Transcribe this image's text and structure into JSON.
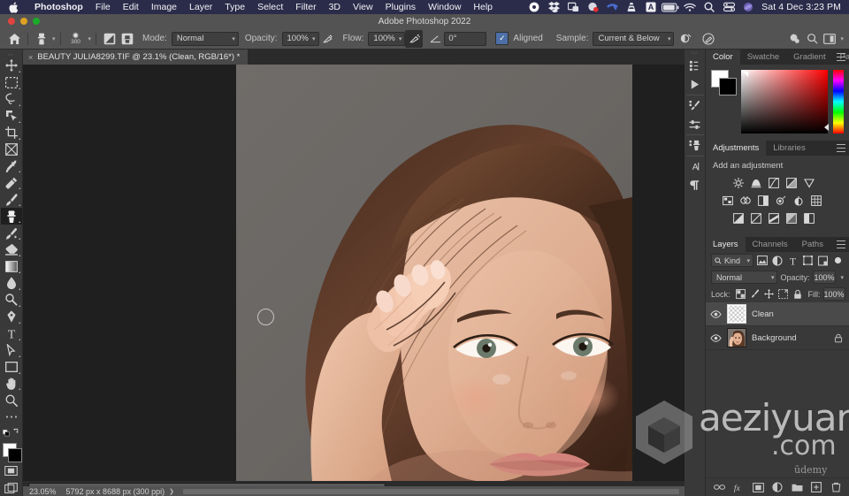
{
  "macbar": {
    "apple_icon": "apple-logo-icon",
    "menus": [
      {
        "label": "Photoshop",
        "bold": true
      },
      {
        "label": "File",
        "bold": false
      },
      {
        "label": "Edit",
        "bold": false
      },
      {
        "label": "Image",
        "bold": false
      },
      {
        "label": "Layer",
        "bold": false
      },
      {
        "label": "Type",
        "bold": false
      },
      {
        "label": "Select",
        "bold": false
      },
      {
        "label": "Filter",
        "bold": false
      },
      {
        "label": "3D",
        "bold": false
      },
      {
        "label": "View",
        "bold": false
      },
      {
        "label": "Plugins",
        "bold": false
      },
      {
        "label": "Window",
        "bold": false
      },
      {
        "label": "Help",
        "bold": false
      }
    ],
    "status_icons": [
      "onedrive-icon",
      "dropbox-icon",
      "screenshot-icon",
      "creative-cloud-icon",
      "phone-icon",
      "vlc-icon",
      "input-source-icon",
      "battery-icon",
      "wifi-icon",
      "spotlight-search-icon",
      "control-center-icon",
      "siri-icon"
    ],
    "clock": "Sat 4 Dec  3:23 PM",
    "bar_color": "#2b2c4a"
  },
  "window": {
    "title": "Adobe Photoshop 2022",
    "traffic_lights": [
      "close-button",
      "minimize-button",
      "zoom-button"
    ]
  },
  "options_bar": {
    "home_icon": "home-icon",
    "tool_preset_icon": "clone-stamp-preset-icon",
    "brush_size": "300",
    "toggle_brush_panel_icon": "brush-settings-panel-icon",
    "toggle_clone_source_icon": "clone-source-panel-icon",
    "mode_label": "Mode:",
    "mode_value": "Normal",
    "opacity_label": "Opacity:",
    "opacity_value": "100%",
    "opacity_pressure_icon": "pressure-opacity-icon",
    "flow_label": "Flow:",
    "flow_value": "100%",
    "airbrush_icon": "airbrush-icon",
    "smoothing_icon": "smoothing-angle-icon",
    "angle_value": "0°",
    "aligned_label": "Aligned",
    "aligned_checked": true,
    "sample_label": "Sample:",
    "sample_value": "Current & Below",
    "ignore_adjustment_icon": "ignore-adjustment-layers-icon",
    "pressure_size_icon": "pressure-size-icon",
    "right_icons": [
      "search-panels-icon",
      "search-icon",
      "workspace-switcher-icon"
    ]
  },
  "document": {
    "tab_title": "BEAUTY JULIA8299.TIF @ 23.1% (Clean, RGB/16*) *",
    "close_icon": "close-tab-icon"
  },
  "toolbar": {
    "tools": [
      {
        "name": "move-tool",
        "icon": "move-icon",
        "active": false,
        "hasflyout": true
      },
      {
        "name": "rectangular-marquee-tool",
        "icon": "marquee-icon",
        "active": false,
        "hasflyout": true
      },
      {
        "name": "lasso-tool",
        "icon": "lasso-icon",
        "active": false,
        "hasflyout": true
      },
      {
        "name": "object-selection-tool",
        "icon": "quick-select-icon",
        "active": false,
        "hasflyout": true
      },
      {
        "name": "crop-tool",
        "icon": "crop-icon",
        "active": false,
        "hasflyout": true
      },
      {
        "name": "frame-tool",
        "icon": "frame-icon",
        "active": false,
        "hasflyout": false
      },
      {
        "name": "eyedropper-tool",
        "icon": "eyedropper-icon",
        "active": false,
        "hasflyout": true
      },
      {
        "name": "spot-healing-brush-tool",
        "icon": "healing-brush-icon",
        "active": false,
        "hasflyout": true
      },
      {
        "name": "brush-tool",
        "icon": "brush-icon",
        "active": false,
        "hasflyout": true
      },
      {
        "name": "clone-stamp-tool",
        "icon": "clone-stamp-icon",
        "active": true,
        "hasflyout": true
      },
      {
        "name": "history-brush-tool",
        "icon": "history-brush-icon",
        "active": false,
        "hasflyout": true
      },
      {
        "name": "eraser-tool",
        "icon": "eraser-icon",
        "active": false,
        "hasflyout": true
      },
      {
        "name": "gradient-tool",
        "icon": "gradient-icon",
        "active": false,
        "hasflyout": true
      },
      {
        "name": "blur-tool",
        "icon": "blur-drop-icon",
        "active": false,
        "hasflyout": true
      },
      {
        "name": "dodge-tool",
        "icon": "dodge-icon",
        "active": false,
        "hasflyout": true
      },
      {
        "name": "pen-tool",
        "icon": "pen-icon",
        "active": false,
        "hasflyout": true
      },
      {
        "name": "type-tool",
        "icon": "type-T-icon",
        "active": false,
        "hasflyout": true
      },
      {
        "name": "path-selection-tool",
        "icon": "path-arrow-icon",
        "active": false,
        "hasflyout": true
      },
      {
        "name": "rectangle-tool",
        "icon": "rectangle-shape-icon",
        "active": false,
        "hasflyout": true
      },
      {
        "name": "hand-tool",
        "icon": "hand-icon",
        "active": false,
        "hasflyout": true
      },
      {
        "name": "zoom-tool",
        "icon": "zoom-magnifier-icon",
        "active": false,
        "hasflyout": false
      },
      {
        "name": "edit-toolbar-button",
        "icon": "ellipsis-icon",
        "active": false,
        "hasflyout": false
      }
    ],
    "default_colors_icon": "default-colors-icon",
    "swap_colors_icon": "swap-colors-icon",
    "foreground_color": "#ffffff",
    "background_color": "#000000",
    "quick_mask_icon": "quick-mask-icon",
    "screen_mode_icon": "screen-mode-icon"
  },
  "dock_rail": {
    "icons": [
      "history-panel-icon",
      "actions-play-icon",
      "brush-settings-icon",
      "brush-presets-icon",
      "clone-source-icon",
      "character-panel-icon",
      "paragraph-panel-icon"
    ]
  },
  "color_panel": {
    "tabs": [
      {
        "label": "Color",
        "active": true
      },
      {
        "label": "Swatche",
        "active": false
      },
      {
        "label": "Gradient",
        "active": false
      },
      {
        "label": "Patterns",
        "active": false
      }
    ],
    "menu_icon": "panel-menu-icon",
    "foreground_color": "#ffffff",
    "background_color": "#000000",
    "ramp": "hue-spectrum"
  },
  "adjustments_panel": {
    "tabs": [
      {
        "label": "Adjustments",
        "active": true
      },
      {
        "label": "Libraries",
        "active": false
      }
    ],
    "menu_icon": "panel-menu-icon",
    "title": "Add an adjustment",
    "rows": [
      [
        "brightness-contrast-icon",
        "levels-icon",
        "curves-icon",
        "exposure-icon",
        "vibrance-icon"
      ],
      [
        "hue-saturation-icon",
        "color-balance-icon",
        "black-white-icon",
        "photo-filter-icon",
        "channel-mixer-icon",
        "color-lookup-icon"
      ],
      [
        "invert-icon",
        "posterize-icon",
        "threshold-icon",
        "gradient-map-icon",
        "selective-color-icon"
      ]
    ]
  },
  "layers_panel": {
    "tabs": [
      {
        "label": "Layers",
        "active": true
      },
      {
        "label": "Channels",
        "active": false
      },
      {
        "label": "Paths",
        "active": false
      }
    ],
    "menu_icon": "panel-menu-icon",
    "filter_label": "Kind",
    "filter_icon": "search-icon",
    "filter_type_icons": [
      "filter-pixel-icon",
      "filter-adjustment-icon",
      "filter-type-icon",
      "filter-shape-icon",
      "filter-smart-object-icon"
    ],
    "filter_toggle_icon": "filter-enable-toggle-icon",
    "blend_mode": "Normal",
    "opacity_label": "Opacity:",
    "opacity_value": "100%",
    "lock_label": "Lock:",
    "lock_icons": [
      "lock-transparent-pixels-icon",
      "lock-image-pixels-icon",
      "lock-position-icon",
      "lock-artboard-nesting-icon",
      "lock-all-icon"
    ],
    "fill_label": "Fill:",
    "fill_value": "100%",
    "layers": [
      {
        "name": "Clean",
        "visible": true,
        "selected": true,
        "locked": false,
        "thumb": "empty-transparent"
      },
      {
        "name": "Background",
        "visible": true,
        "selected": false,
        "locked": true,
        "thumb": "portrait-photo"
      }
    ],
    "footer_icons": [
      "link-layers-icon",
      "add-layer-style-icon",
      "add-layer-mask-icon",
      "new-adjustment-layer-icon",
      "new-group-icon",
      "new-layer-icon",
      "delete-layer-icon"
    ]
  },
  "status_bar": {
    "zoom": "23.05%",
    "dimensions": "5792 px x 8688 px (300 ppi)",
    "expand_icon": "status-expand-icon"
  },
  "canvas": {
    "brush_cursor": "circle-brush-cursor",
    "image_description": "portrait-photo-woman-hand-on-face",
    "background_color": "#1f1f1f",
    "photo_backdrop": "#6a6764"
  },
  "watermark": {
    "logo_icon": "aeziyuan-cube-logo-icon",
    "line1": "aeziyuan",
    "line2": ".com",
    "line3": "ūdemy"
  }
}
